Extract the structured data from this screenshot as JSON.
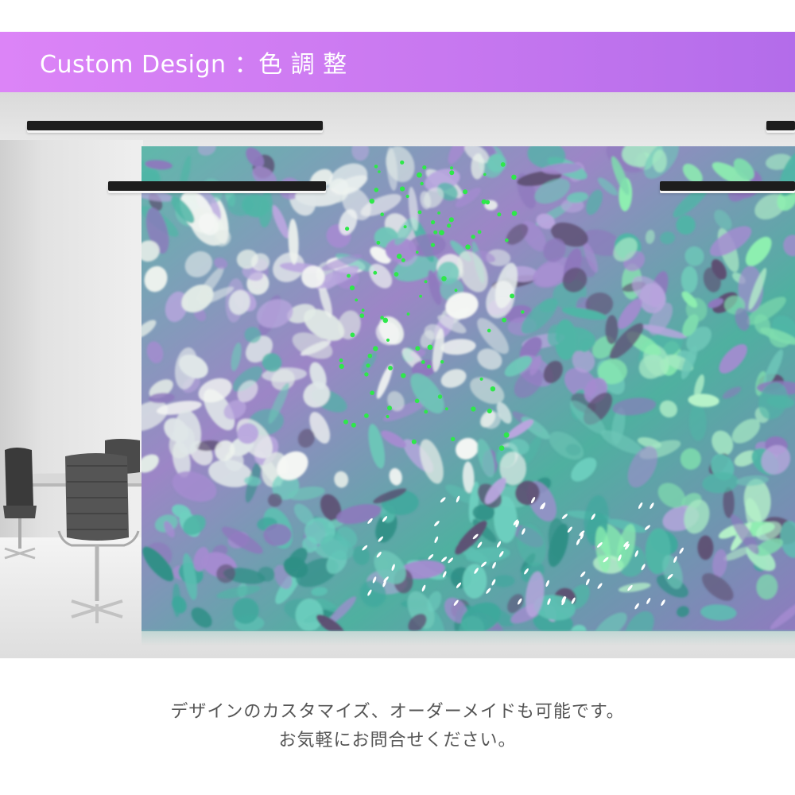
{
  "banner": {
    "title": "Custom Design ：色 調 整"
  },
  "caption": {
    "line1": "デザインのカスタマイズ、オーダーメイドも可能です。",
    "line2": "お気軽にお問合せください。"
  },
  "colors": {
    "banner_left": "#dc84f7",
    "banner_right": "#b36cea",
    "mural_teal": "#4fb5a6",
    "mural_lavender": "#a58bd0",
    "mural_white": "#eef3ee",
    "mural_green": "#8ef0b0",
    "caption_text": "#555555"
  },
  "icons": [
    "office-chair-icon",
    "ceiling-light-icon"
  ]
}
